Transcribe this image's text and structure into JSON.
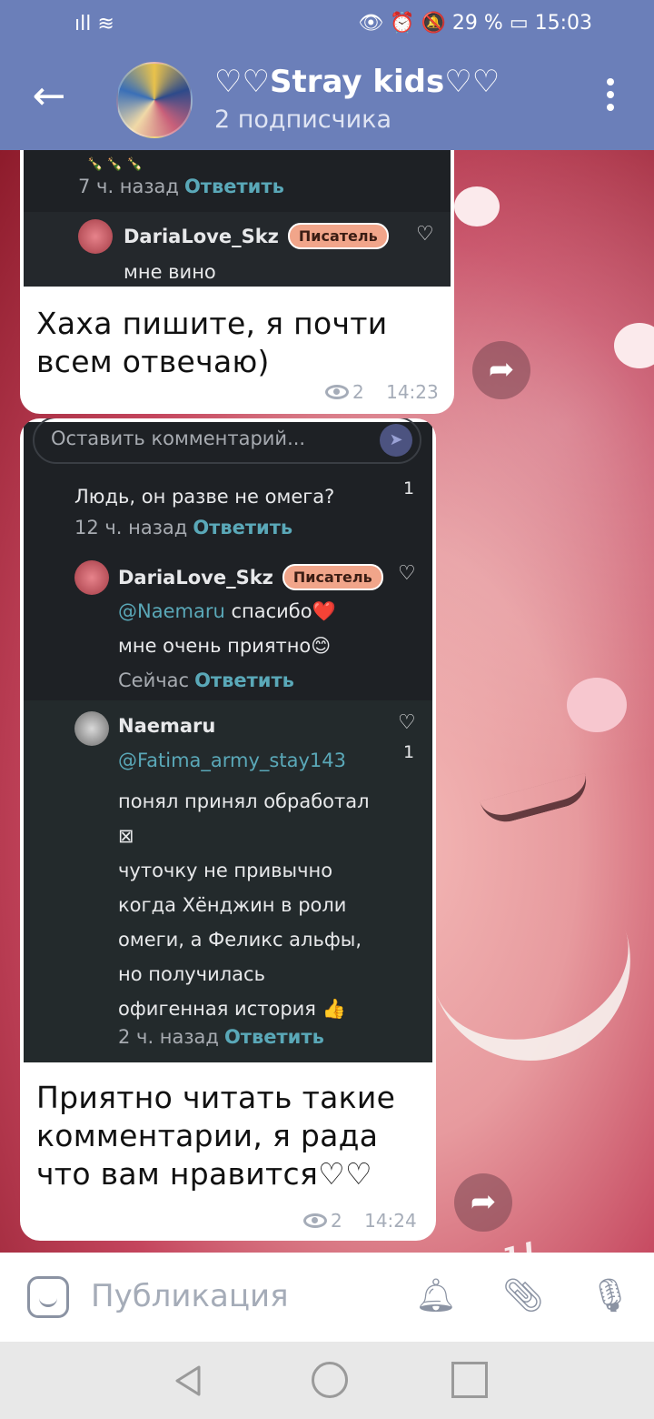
{
  "status_bar": {
    "left": "ıll ≋",
    "right": "👁 ⏰ 🔕 29 % ▭ 15:03"
  },
  "header": {
    "back_icon": "←",
    "title": "♡♡Stray kids♡♡",
    "subtitle": "2 подписчика"
  },
  "messages": [
    {
      "screenshot": {
        "prev_time": "7 ч. назад",
        "prev_reply": "Ответить",
        "author": "DariaLove_Skz",
        "author_badge": "Писатель",
        "comment": "мне вино"
      },
      "text": "Хаха пишите, я почти всем отвечаю)",
      "views": "2",
      "time": "14:23"
    },
    {
      "screenshot": {
        "input_placeholder": "Оставить комментарий...",
        "c1_text": "Людь, он разве не омега?",
        "c1_likes": "1",
        "c1_time": "12 ч. назад",
        "c1_reply": "Ответить",
        "c2_author": "DariaLove_Skz",
        "c2_badge": "Писатель",
        "c2_mention": "@Naemaru",
        "c2_line1": " спасибо❤️",
        "c2_line2": "мне очень приятно😊",
        "c2_time": "Сейчас",
        "c2_reply": "Ответить",
        "c3_author": "Naemaru",
        "c3_likes": "1",
        "c3_mention": "@Fatima_army_stay143",
        "c3_lines": [
          "понял принял обработал",
          "⊠",
          "чуточку не привычно",
          "когда Хёнджин в роли",
          "омеги, а  Феликс альфы,",
          "но получилась",
          "офигенная история 👍"
        ],
        "c3_time": "2 ч. назад",
        "c3_reply": "Ответить"
      },
      "text": "Приятно читать такие комментарии, я рада что вам нравится♡♡",
      "views": "2",
      "time": "14:24"
    }
  ],
  "composer": {
    "placeholder": "Публикация"
  }
}
